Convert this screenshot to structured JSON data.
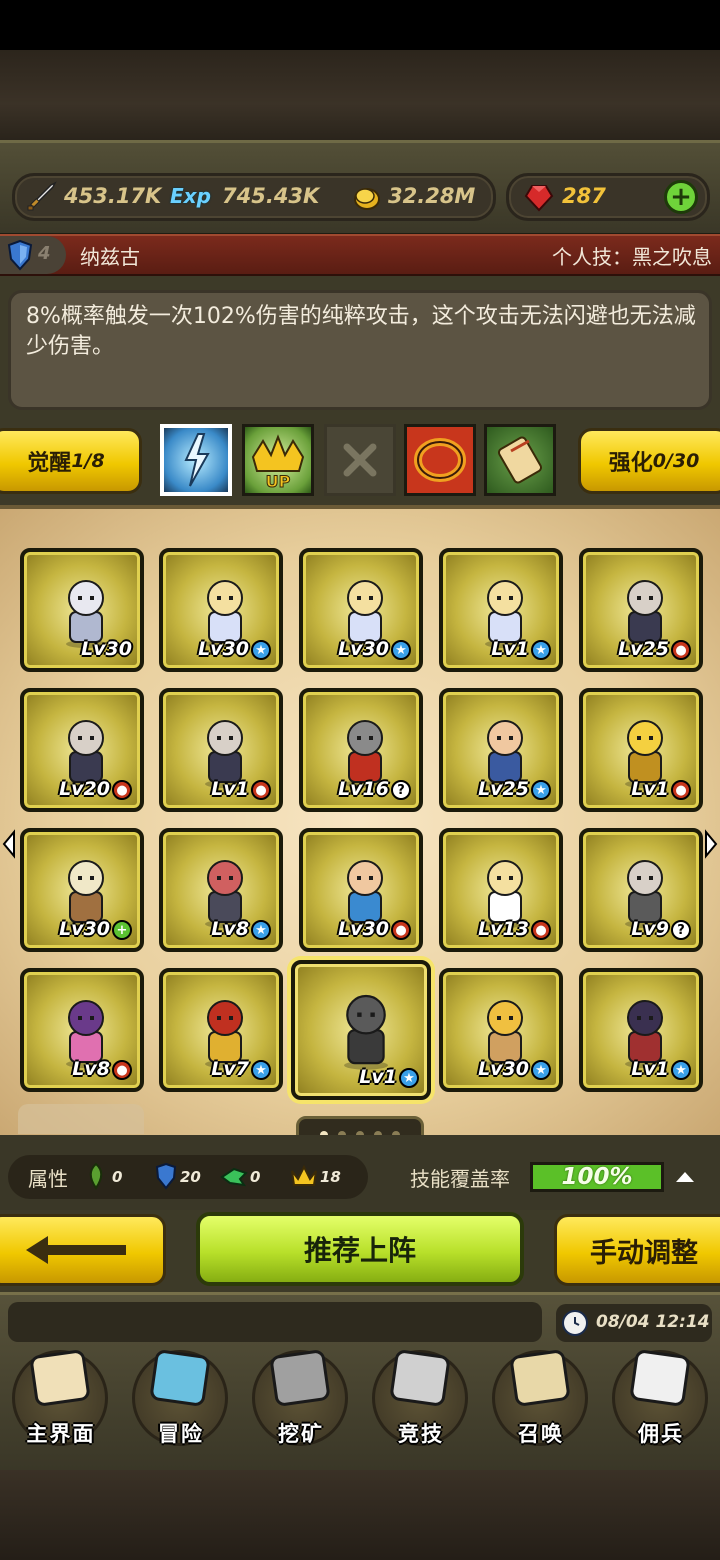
{
  "resources": {
    "attack": "453.17K",
    "exp_icon": "Exp",
    "exp": "745.43K",
    "gold": "32.28M",
    "gems": "287"
  },
  "hero": {
    "level_badge": "4",
    "name": "纳兹古",
    "skill_label": "个人技：黑之吹息",
    "description": "8%概率触发一次102%伤害的纯粹攻击，这个攻击无法闪避也无法减少伤害。"
  },
  "tabs": {
    "awaken_label": "觉醒",
    "awaken_count": "1/8",
    "enhance_label": "强化",
    "enhance_count": "0/30",
    "upgrade_icon_text": "UP"
  },
  "cards": [
    {
      "level": "Lv30",
      "badge": "",
      "figure": "bear"
    },
    {
      "level": "Lv30",
      "badge": "star",
      "figure": "blonde"
    },
    {
      "level": "Lv30",
      "badge": "star",
      "figure": "blonde"
    },
    {
      "level": "Lv1",
      "badge": "star",
      "figure": "blonde"
    },
    {
      "level": "Lv25",
      "badge": "red",
      "figure": "bearded"
    },
    {
      "level": "Lv20",
      "badge": "red",
      "figure": "bearded"
    },
    {
      "level": "Lv1",
      "badge": "red",
      "figure": "bearded"
    },
    {
      "level": "Lv16",
      "badge": "q",
      "figure": "knight"
    },
    {
      "level": "Lv25",
      "badge": "star",
      "figure": "bald"
    },
    {
      "level": "Lv1",
      "badge": "red",
      "figure": "star"
    },
    {
      "level": "Lv30",
      "badge": "plus",
      "figure": "king"
    },
    {
      "level": "Lv8",
      "badge": "star",
      "figure": "redhair"
    },
    {
      "level": "Lv30",
      "badge": "red",
      "figure": "wrestler"
    },
    {
      "level": "Lv13",
      "badge": "red",
      "figure": "angel"
    },
    {
      "level": "Lv9",
      "badge": "q",
      "figure": "dwarf"
    },
    {
      "level": "Lv8",
      "badge": "red",
      "figure": "purple"
    },
    {
      "level": "Lv7",
      "badge": "star",
      "figure": "samurai"
    },
    {
      "level": "Lv1",
      "badge": "star",
      "figure": "hooded"
    },
    {
      "level": "Lv30",
      "badge": "star",
      "figure": "golden"
    },
    {
      "level": "Lv1",
      "badge": "star",
      "figure": "dark"
    }
  ],
  "pager": {
    "pages": 5,
    "active": 1
  },
  "attributes": {
    "label": "属性",
    "nature": "0",
    "shield": "20",
    "wing": "0",
    "crown": "18",
    "coverage_label": "技能覆盖率",
    "coverage_value": "100%"
  },
  "actions": {
    "recommend": "推荐上阵",
    "manual": "手动调整"
  },
  "status": {
    "time": "08/04 12:14"
  },
  "nav": [
    {
      "label": "主界面",
      "icon": "map-scroll-icon"
    },
    {
      "label": "冒险",
      "icon": "island-icon"
    },
    {
      "label": "挖矿",
      "icon": "pickaxe-icon"
    },
    {
      "label": "竞技",
      "icon": "crossed-swords-icon"
    },
    {
      "label": "召唤",
      "icon": "summon-scroll-icon"
    },
    {
      "label": "佣兵",
      "icon": "tent-icon"
    }
  ],
  "colors": {
    "gold_button": "#f0c800",
    "green_button": "#b8e02a",
    "name_bar": "#7b2a1c",
    "coverage": "#5bc028"
  }
}
